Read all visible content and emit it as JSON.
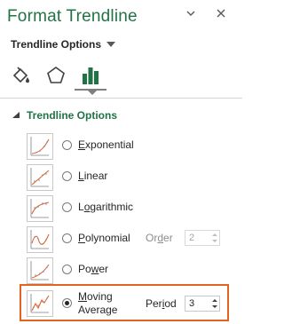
{
  "pane": {
    "title": "Format Trendline",
    "collapse_icon": "chevron-down-icon",
    "close_icon": "close-icon"
  },
  "options_dropdown": {
    "label": "Trendline Options"
  },
  "tabs": [
    {
      "name": "fill-line",
      "icon": "paint-bucket-icon"
    },
    {
      "name": "effects",
      "icon": "pentagon-icon"
    },
    {
      "name": "trendline-options",
      "icon": "bar-chart-icon",
      "selected": true
    }
  ],
  "section": {
    "label": "Trendline Options",
    "expanded": true
  },
  "types": [
    {
      "key": "exponential",
      "u": "E",
      "rest": "xponential",
      "selected": false
    },
    {
      "key": "linear",
      "u": "L",
      "rest": "inear",
      "selected": false
    },
    {
      "key": "logarithmic",
      "pre": "L",
      "u": "o",
      "rest": "garithmic",
      "selected": false
    },
    {
      "key": "polynomial",
      "u": "P",
      "rest": "olynomial",
      "selected": false
    },
    {
      "key": "power",
      "pre": "Po",
      "u": "w",
      "rest": "er",
      "selected": false
    },
    {
      "key": "moving-average",
      "u": "M",
      "rest": "oving",
      "line2": "Average",
      "selected": true
    }
  ],
  "order": {
    "pre": "Or",
    "u": "d",
    "rest": "er",
    "value": "2",
    "enabled": false
  },
  "period": {
    "pre": "Per",
    "u": "i",
    "rest": "od",
    "value": "3",
    "enabled": true
  },
  "colors": {
    "accent": "#217346",
    "highlight": "#e8621f"
  }
}
